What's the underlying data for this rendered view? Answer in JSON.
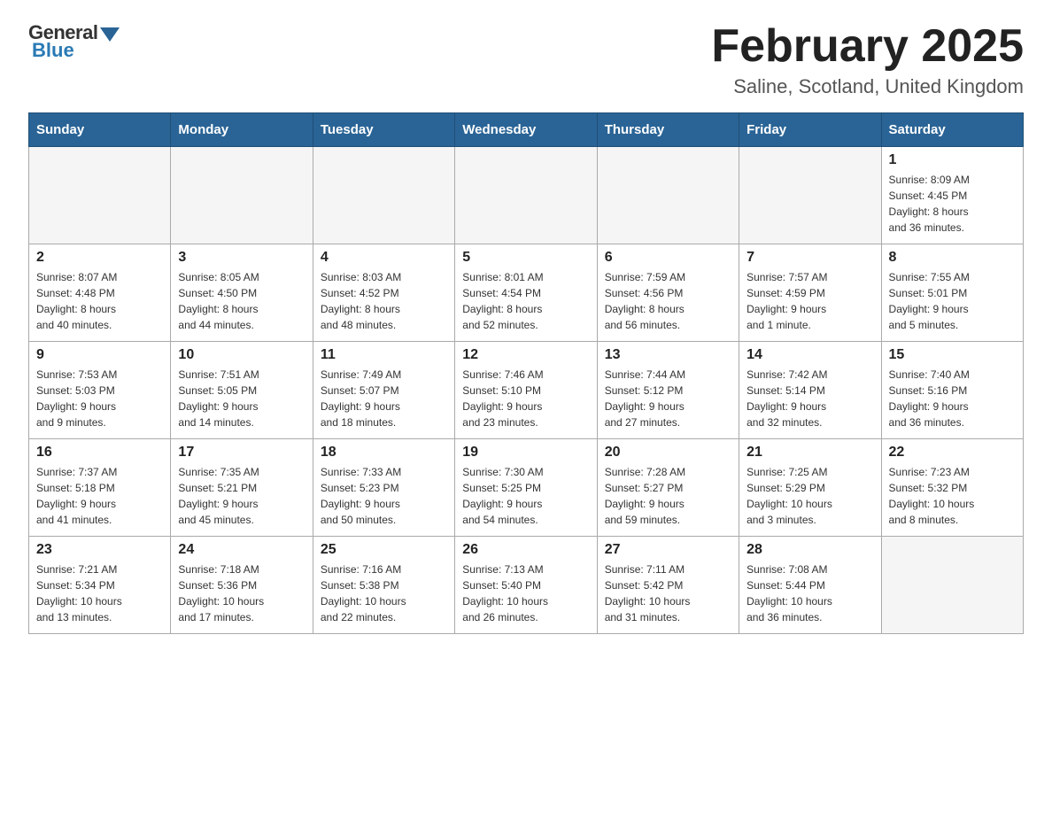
{
  "logo": {
    "general": "General",
    "blue": "Blue"
  },
  "title": "February 2025",
  "subtitle": "Saline, Scotland, United Kingdom",
  "days_of_week": [
    "Sunday",
    "Monday",
    "Tuesday",
    "Wednesday",
    "Thursday",
    "Friday",
    "Saturday"
  ],
  "weeks": [
    [
      {
        "day": "",
        "info": ""
      },
      {
        "day": "",
        "info": ""
      },
      {
        "day": "",
        "info": ""
      },
      {
        "day": "",
        "info": ""
      },
      {
        "day": "",
        "info": ""
      },
      {
        "day": "",
        "info": ""
      },
      {
        "day": "1",
        "info": "Sunrise: 8:09 AM\nSunset: 4:45 PM\nDaylight: 8 hours\nand 36 minutes."
      }
    ],
    [
      {
        "day": "2",
        "info": "Sunrise: 8:07 AM\nSunset: 4:48 PM\nDaylight: 8 hours\nand 40 minutes."
      },
      {
        "day": "3",
        "info": "Sunrise: 8:05 AM\nSunset: 4:50 PM\nDaylight: 8 hours\nand 44 minutes."
      },
      {
        "day": "4",
        "info": "Sunrise: 8:03 AM\nSunset: 4:52 PM\nDaylight: 8 hours\nand 48 minutes."
      },
      {
        "day": "5",
        "info": "Sunrise: 8:01 AM\nSunset: 4:54 PM\nDaylight: 8 hours\nand 52 minutes."
      },
      {
        "day": "6",
        "info": "Sunrise: 7:59 AM\nSunset: 4:56 PM\nDaylight: 8 hours\nand 56 minutes."
      },
      {
        "day": "7",
        "info": "Sunrise: 7:57 AM\nSunset: 4:59 PM\nDaylight: 9 hours\nand 1 minute."
      },
      {
        "day": "8",
        "info": "Sunrise: 7:55 AM\nSunset: 5:01 PM\nDaylight: 9 hours\nand 5 minutes."
      }
    ],
    [
      {
        "day": "9",
        "info": "Sunrise: 7:53 AM\nSunset: 5:03 PM\nDaylight: 9 hours\nand 9 minutes."
      },
      {
        "day": "10",
        "info": "Sunrise: 7:51 AM\nSunset: 5:05 PM\nDaylight: 9 hours\nand 14 minutes."
      },
      {
        "day": "11",
        "info": "Sunrise: 7:49 AM\nSunset: 5:07 PM\nDaylight: 9 hours\nand 18 minutes."
      },
      {
        "day": "12",
        "info": "Sunrise: 7:46 AM\nSunset: 5:10 PM\nDaylight: 9 hours\nand 23 minutes."
      },
      {
        "day": "13",
        "info": "Sunrise: 7:44 AM\nSunset: 5:12 PM\nDaylight: 9 hours\nand 27 minutes."
      },
      {
        "day": "14",
        "info": "Sunrise: 7:42 AM\nSunset: 5:14 PM\nDaylight: 9 hours\nand 32 minutes."
      },
      {
        "day": "15",
        "info": "Sunrise: 7:40 AM\nSunset: 5:16 PM\nDaylight: 9 hours\nand 36 minutes."
      }
    ],
    [
      {
        "day": "16",
        "info": "Sunrise: 7:37 AM\nSunset: 5:18 PM\nDaylight: 9 hours\nand 41 minutes."
      },
      {
        "day": "17",
        "info": "Sunrise: 7:35 AM\nSunset: 5:21 PM\nDaylight: 9 hours\nand 45 minutes."
      },
      {
        "day": "18",
        "info": "Sunrise: 7:33 AM\nSunset: 5:23 PM\nDaylight: 9 hours\nand 50 minutes."
      },
      {
        "day": "19",
        "info": "Sunrise: 7:30 AM\nSunset: 5:25 PM\nDaylight: 9 hours\nand 54 minutes."
      },
      {
        "day": "20",
        "info": "Sunrise: 7:28 AM\nSunset: 5:27 PM\nDaylight: 9 hours\nand 59 minutes."
      },
      {
        "day": "21",
        "info": "Sunrise: 7:25 AM\nSunset: 5:29 PM\nDaylight: 10 hours\nand 3 minutes."
      },
      {
        "day": "22",
        "info": "Sunrise: 7:23 AM\nSunset: 5:32 PM\nDaylight: 10 hours\nand 8 minutes."
      }
    ],
    [
      {
        "day": "23",
        "info": "Sunrise: 7:21 AM\nSunset: 5:34 PM\nDaylight: 10 hours\nand 13 minutes."
      },
      {
        "day": "24",
        "info": "Sunrise: 7:18 AM\nSunset: 5:36 PM\nDaylight: 10 hours\nand 17 minutes."
      },
      {
        "day": "25",
        "info": "Sunrise: 7:16 AM\nSunset: 5:38 PM\nDaylight: 10 hours\nand 22 minutes."
      },
      {
        "day": "26",
        "info": "Sunrise: 7:13 AM\nSunset: 5:40 PM\nDaylight: 10 hours\nand 26 minutes."
      },
      {
        "day": "27",
        "info": "Sunrise: 7:11 AM\nSunset: 5:42 PM\nDaylight: 10 hours\nand 31 minutes."
      },
      {
        "day": "28",
        "info": "Sunrise: 7:08 AM\nSunset: 5:44 PM\nDaylight: 10 hours\nand 36 minutes."
      },
      {
        "day": "",
        "info": ""
      }
    ]
  ]
}
